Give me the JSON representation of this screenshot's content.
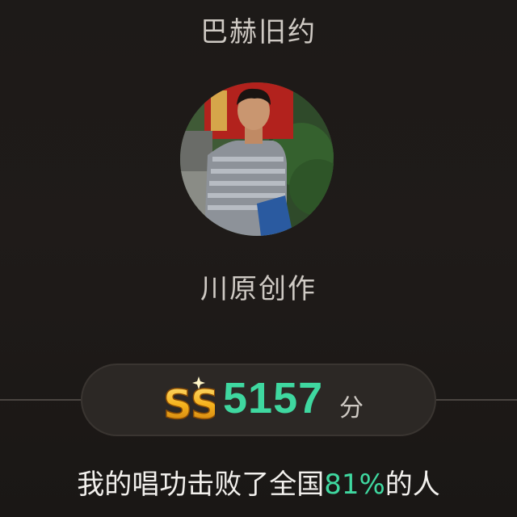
{
  "song": {
    "title": "巴赫旧约"
  },
  "artist": {
    "name": "川原创作"
  },
  "score": {
    "grade": "SS",
    "value": "5157",
    "unit": "分"
  },
  "result": {
    "prefix": "我的唱功击败了全国",
    "percent": "81%",
    "suffix": "的人"
  },
  "colors": {
    "accent": "#3fd8a0",
    "background": "#1b1816",
    "grade_gold": "#f5b21d"
  }
}
